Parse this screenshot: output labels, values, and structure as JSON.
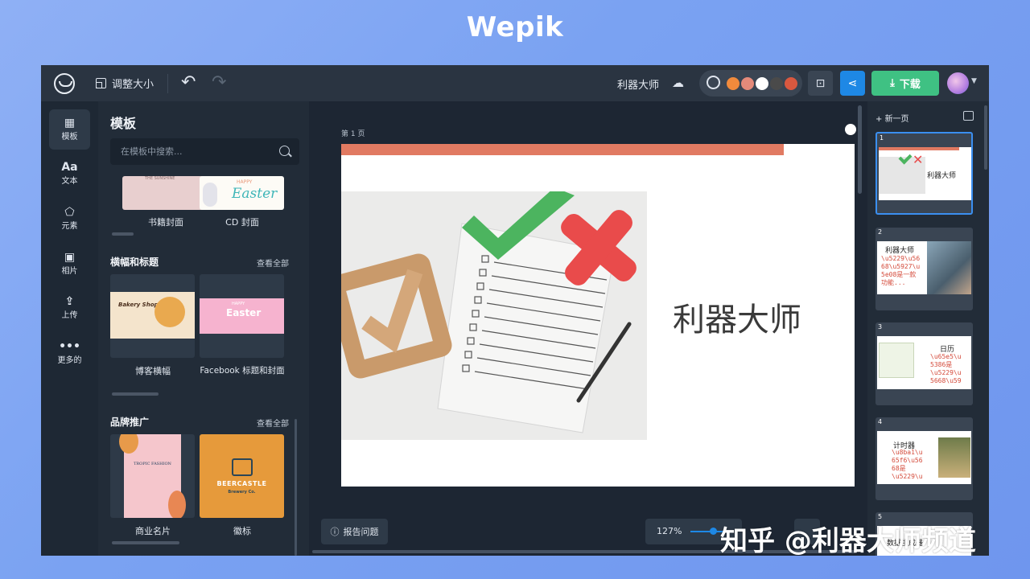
{
  "site_title": "Wepik",
  "topbar": {
    "resize_label": "调整大小",
    "doc_title": "利器大师",
    "download_label": "下载",
    "swatches": [
      "#f08a3c",
      "#e58a7a",
      "#ffffff",
      "#4a4a4a",
      "#d9583f"
    ]
  },
  "rail": {
    "items": [
      {
        "label": "模板",
        "icon": "grid-icon"
      },
      {
        "label": "文本",
        "icon": "Aa"
      },
      {
        "label": "元素",
        "icon": "shapes-icon"
      },
      {
        "label": "相片",
        "icon": "photo-icon"
      },
      {
        "label": "上传",
        "icon": "upload-icon"
      },
      {
        "label": "更多的",
        "icon": "more-icon"
      }
    ]
  },
  "panel": {
    "title": "模板",
    "search_placeholder": "在模板中搜索...",
    "top_items": [
      {
        "label": "书籍封面",
        "thumb_text": "THE SUNSHINE"
      },
      {
        "label": "CD 封面",
        "thumb_text": "Easter",
        "thumb_sub": "HAPPY"
      }
    ],
    "sections": [
      {
        "title": "横幅和标题",
        "see_all": "查看全部",
        "items": [
          {
            "label": "博客横幅",
            "thumb_text": "Bakery Shop"
          },
          {
            "label": "Facebook 标题和封面",
            "thumb_text": "Easter",
            "thumb_sub": "HAPPY"
          }
        ]
      },
      {
        "title": "品牌推广",
        "see_all": "查看全部",
        "items": [
          {
            "label": "商业名片",
            "thumb_text": "TROPIC FASHION"
          },
          {
            "label": "徽标",
            "thumb_text": "BEERCASTLE",
            "thumb_sub": "Brewery Co."
          }
        ]
      }
    ]
  },
  "canvas": {
    "page_label": "第 1 页",
    "slide_title": "利器大师",
    "report_label": "报告问题",
    "zoom": "127%"
  },
  "pages": {
    "new_page": "新一页",
    "items": [
      {
        "num": "1",
        "text": "利器大师"
      },
      {
        "num": "2",
        "text": "利器大师",
        "red": "\\u5229\\u56\n68\\u5927\\u\n5e08是一款\n功能..."
      },
      {
        "num": "3",
        "text": "日历",
        "red": "\\u65e5\\u\n5386是\n\\u5229\\u\n5668\\u59"
      },
      {
        "num": "4",
        "text": "计时器",
        "red": "\\u8ba1\\u\n65f6\\u56\n68是\n\\u5229\\u"
      },
      {
        "num": "5",
        "text": "数据生成器"
      }
    ]
  },
  "watermark": "知乎 @利器大师频道"
}
